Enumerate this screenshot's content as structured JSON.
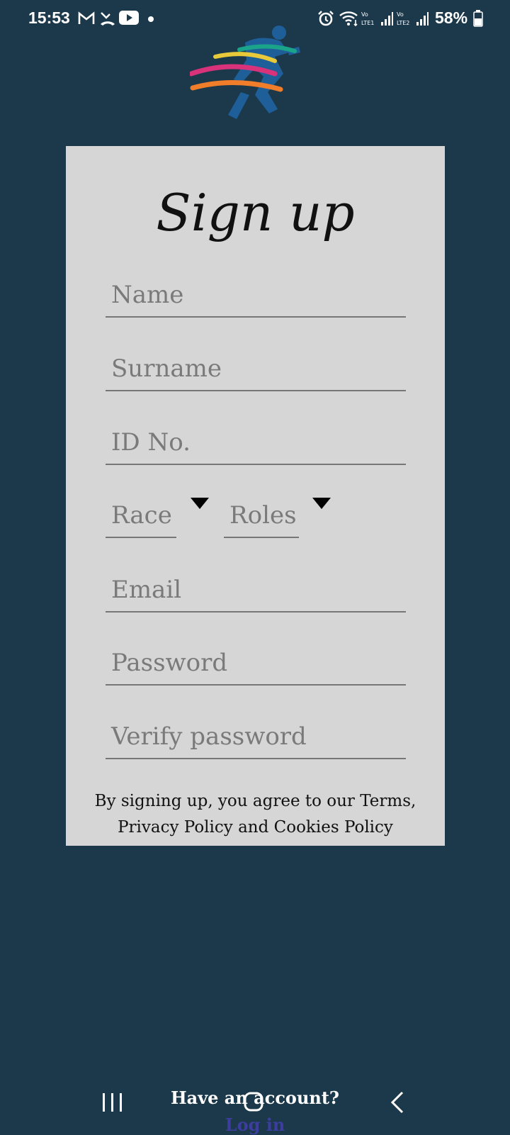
{
  "status_bar": {
    "time": "15:53",
    "battery": "58%",
    "icons": [
      "gmail-icon",
      "missed-call-icon",
      "youtube-icon",
      "dot-icon",
      "alarm-icon",
      "wifi-icon",
      "signal-lte1-icon",
      "signal-lte2-icon",
      "battery-icon"
    ]
  },
  "form": {
    "title": "Sign up",
    "name_placeholder": "Name",
    "surname_placeholder": "Surname",
    "id_placeholder": "ID No.",
    "race_placeholder": "Race",
    "roles_placeholder": "Roles",
    "email_placeholder": "Email",
    "password_placeholder": "Password",
    "verify_password_placeholder": "Verify password",
    "terms_line1": "By signing up, you agree to our Terms,",
    "terms_line2": "Privacy Policy and Cookies Policy"
  },
  "footer": {
    "have_account": "Have an account?",
    "login": "Log in"
  },
  "colors": {
    "background": "#1c394c",
    "card": "#d6d6d6",
    "link": "#3c3d9e"
  }
}
